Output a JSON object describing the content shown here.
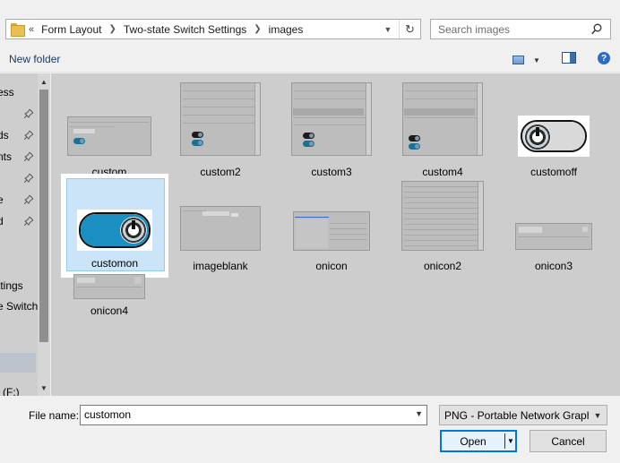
{
  "address_bar": {
    "overflow": "«",
    "crumbs": [
      "Form Layout",
      "Two-state Switch Settings",
      "images"
    ]
  },
  "search": {
    "placeholder": "Search images"
  },
  "toolbar": {
    "new_folder": "New folder"
  },
  "nav": {
    "items": [
      "ess",
      "ds",
      "nts",
      "e",
      "d",
      "ttings",
      "e Switch",
      "(F:)"
    ]
  },
  "files": [
    "custom",
    "custom2",
    "custom3",
    "custom4",
    "customoff",
    "customon",
    "imageblank",
    "onicon",
    "onicon2",
    "onicon3",
    "onicon4"
  ],
  "selected_file": "customon",
  "bottom": {
    "file_name_label": "File name:",
    "file_name_value": "customon",
    "file_type": "PNG - Portable Network Graphics",
    "open_label": "Open",
    "cancel_label": "Cancel"
  },
  "colors": {
    "accent": "#0078d7",
    "selection_fill": "#cbe4f8",
    "switch_on": "#1a8fc1"
  }
}
